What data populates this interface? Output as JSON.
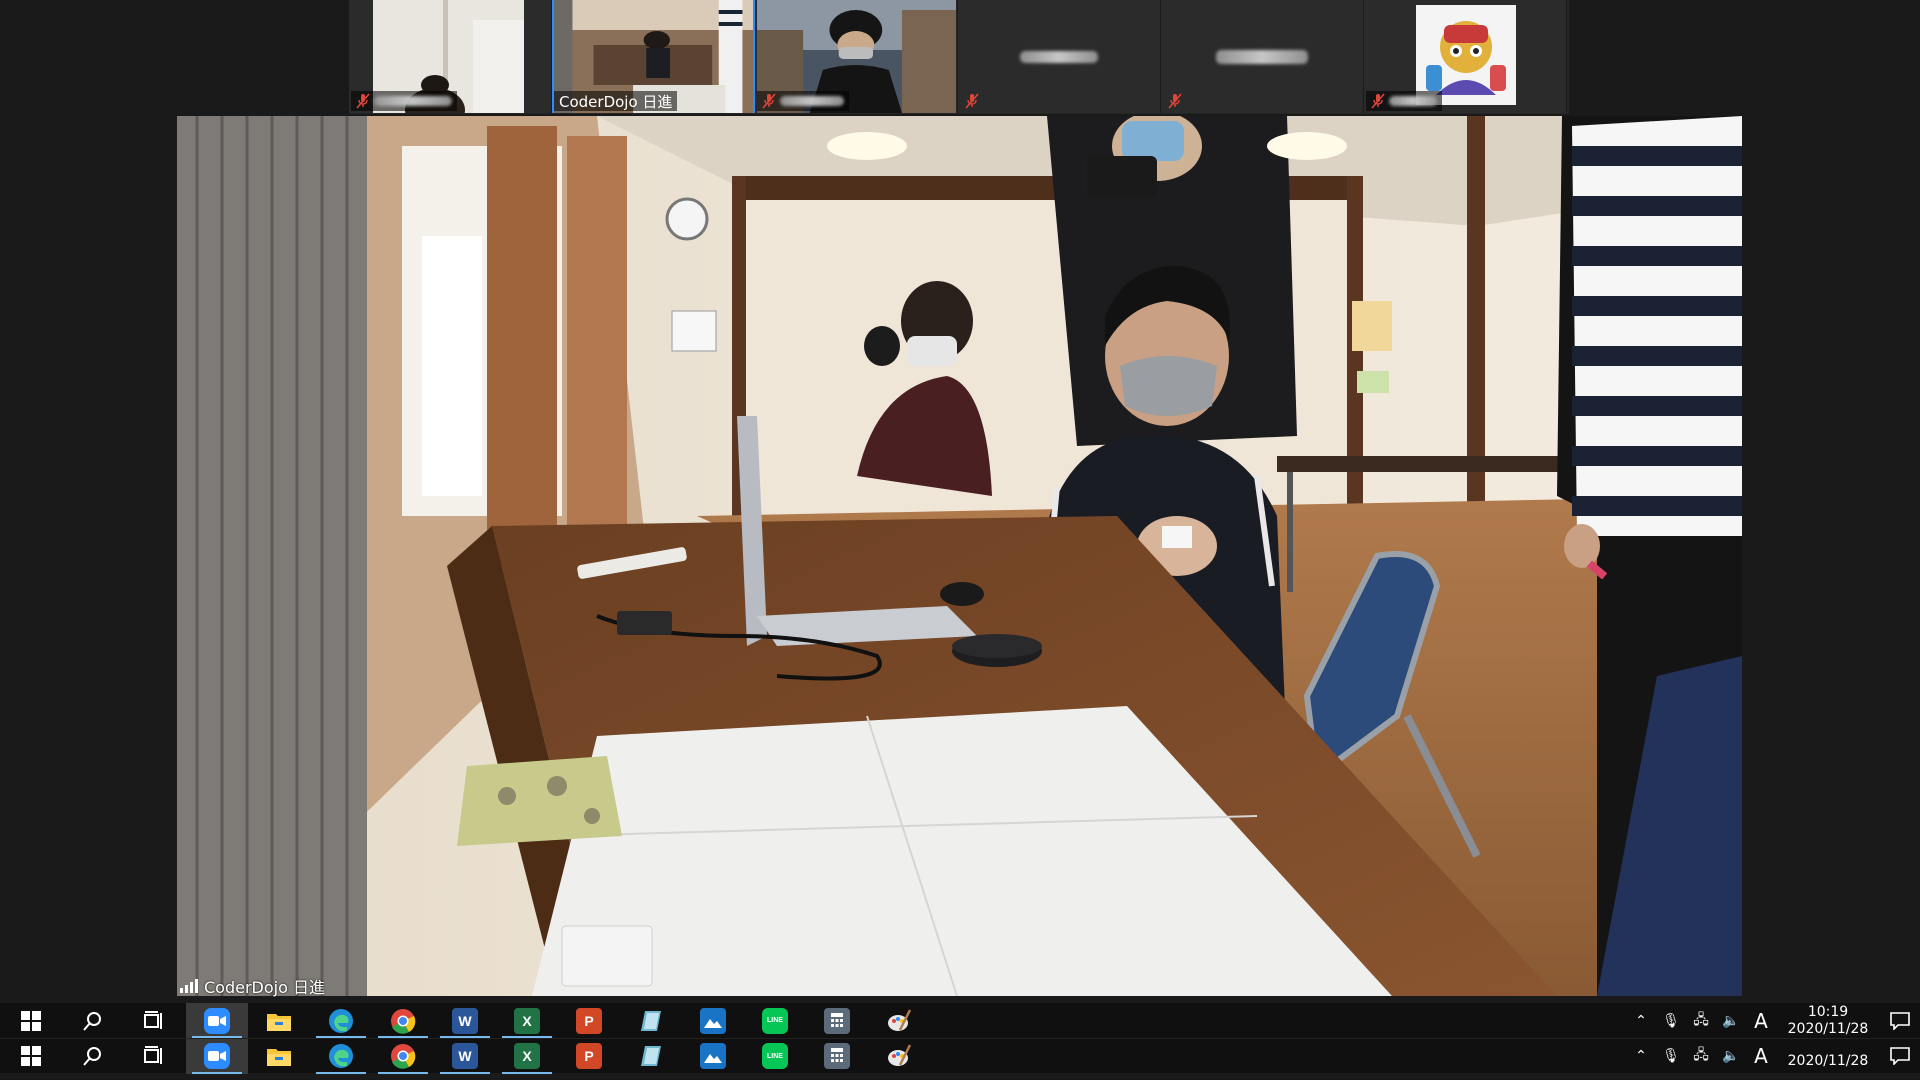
{
  "gallery": {
    "tiles": [
      {
        "name": "",
        "muted": true,
        "kind": "video-room"
      },
      {
        "name": "CoderDojo 日進",
        "muted": false,
        "kind": "video-room-wide",
        "active": true
      },
      {
        "name": "",
        "muted": true,
        "kind": "video-kid-street"
      },
      {
        "name": "",
        "muted": true,
        "kind": "name-only"
      },
      {
        "name": "",
        "muted": true,
        "kind": "name-only"
      },
      {
        "name": "",
        "muted": true,
        "kind": "avatar"
      }
    ]
  },
  "main": {
    "speaker_name": "CoderDojo 日進"
  },
  "taskbar": {
    "apps": [
      {
        "icon": "zoom-icon",
        "color": "#2d8cff",
        "glyph": "",
        "active": true,
        "running": true
      },
      {
        "icon": "file-explorer-icon",
        "color": "#f8c537",
        "glyph": "",
        "running": false
      },
      {
        "icon": "edge-icon",
        "color": "#1e8fd8",
        "glyph": "e",
        "running": true
      },
      {
        "icon": "chrome-icon",
        "color": "#e0483e",
        "glyph": "",
        "running": true
      },
      {
        "icon": "word-icon",
        "color": "#2b579a",
        "glyph": "W",
        "running": true
      },
      {
        "icon": "excel-icon",
        "color": "#217346",
        "glyph": "X",
        "running": true
      },
      {
        "icon": "powerpoint-icon",
        "color": "#d24726",
        "glyph": "P",
        "running": false
      },
      {
        "icon": "sticky-app-icon",
        "color": "#6fb8d0",
        "glyph": "",
        "running": false
      },
      {
        "icon": "photos-icon",
        "color": "#1a74c6",
        "glyph": "",
        "running": false
      },
      {
        "icon": "line-icon",
        "color": "#06c755",
        "glyph": "LINE",
        "running": false
      },
      {
        "icon": "calculator-icon",
        "color": "#5b6b7a",
        "glyph": "",
        "running": false
      },
      {
        "icon": "paint-icon",
        "color": "#e8e8e8",
        "glyph": "",
        "running": false
      }
    ],
    "ime": "A",
    "time": "10:19",
    "date": "2020/11/28"
  }
}
